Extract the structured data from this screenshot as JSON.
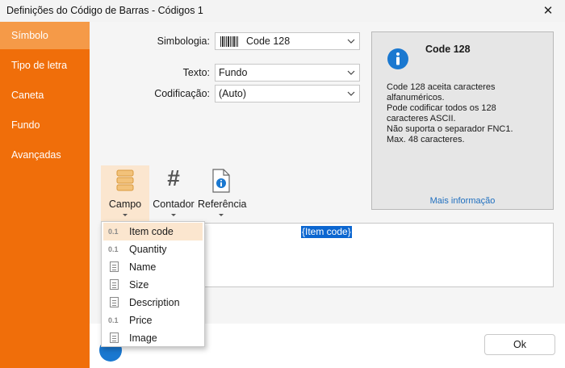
{
  "window": {
    "title": "Definições do Código de Barras - Códigos 1",
    "close_glyph": "✕"
  },
  "sidebar": {
    "items": [
      {
        "label": "Símbolo",
        "selected": true
      },
      {
        "label": "Tipo de letra",
        "selected": false
      },
      {
        "label": "Caneta",
        "selected": false
      },
      {
        "label": "Fundo",
        "selected": false
      },
      {
        "label": "Avançadas",
        "selected": false
      }
    ]
  },
  "form": {
    "symbology_label": "Simbologia:",
    "symbology_value": "Code 128",
    "text_label": "Texto:",
    "text_value": "Fundo",
    "encoding_label": "Codificação:",
    "encoding_value": "(Auto)"
  },
  "info": {
    "title": "Code 128",
    "lines": [
      "Code 128 aceita caracteres",
      "alfanuméricos.",
      "Pode codificar todos os 128",
      "caracteres ASCII.",
      "Não suporta o separador FNC1.",
      "Max. 48 caracteres."
    ],
    "more_link": "Mais informação"
  },
  "toolbar": {
    "campo": "Campo",
    "contador": "Contador",
    "contador_glyph": "#",
    "referencia": "Referência"
  },
  "editor": {
    "token": "{Item code}"
  },
  "field_menu": {
    "items": [
      {
        "label": "Item code",
        "glyph": "0.1",
        "kind": "numeric",
        "selected": true
      },
      {
        "label": "Quantity",
        "glyph": "0.1",
        "kind": "numeric",
        "selected": false
      },
      {
        "label": "Name",
        "glyph": "",
        "kind": "text",
        "selected": false
      },
      {
        "label": "Size",
        "glyph": "",
        "kind": "text",
        "selected": false
      },
      {
        "label": "Description",
        "glyph": "",
        "kind": "text",
        "selected": false
      },
      {
        "label": "Price",
        "glyph": "0.1",
        "kind": "numeric",
        "selected": false
      },
      {
        "label": "Image",
        "glyph": "",
        "kind": "text",
        "selected": false
      }
    ]
  },
  "footer": {
    "ok_label": "Ok"
  },
  "colors": {
    "sidebar": "#f06e0a",
    "sidebar_selected": "#f59a48",
    "accent_blue": "#1a78d0",
    "selection_highlight": "#fbe6cf"
  }
}
